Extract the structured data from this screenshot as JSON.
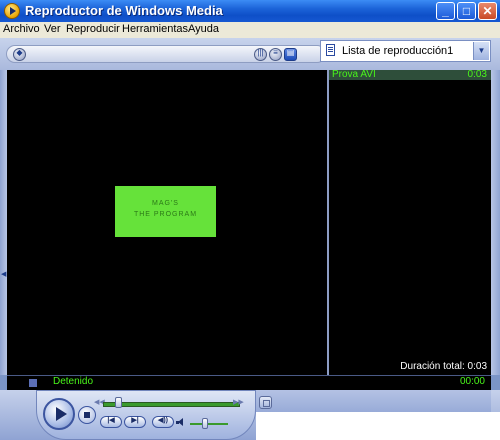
{
  "window": {
    "title": "Reproductor de Windows Media",
    "minimize": "_",
    "maximize": "□",
    "close": "✕"
  },
  "menu": [
    "Archivo",
    "Ver",
    "Reproducir",
    "Herramientas",
    "Ayuda"
  ],
  "toolbar": {
    "icons": [
      "collapse-icon",
      "visualizations-icon",
      "eq-icon",
      "playlist-icon"
    ]
  },
  "playlist_selector": {
    "value": "Lista de reproducción1"
  },
  "playlist": {
    "items": [
      {
        "title": "Prova AVI",
        "duration": "0:03"
      }
    ],
    "total": "Duración total: 0:03"
  },
  "video": {
    "overlay_line1": "MAG'S",
    "overlay_line2": "THE PROGRAM"
  },
  "status": {
    "text": "Detenido",
    "time": "00:00"
  },
  "colors": {
    "status_green": "#49f51a",
    "clip_green": "#66e23a",
    "title_blue": "#1b63d8"
  }
}
